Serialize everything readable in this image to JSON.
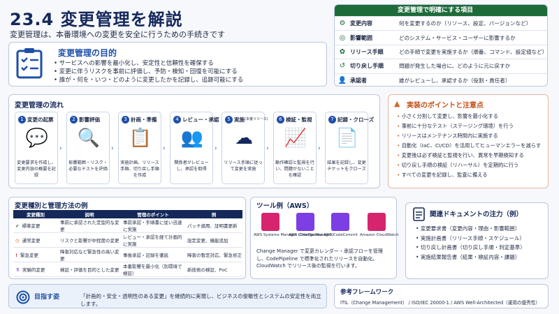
{
  "title": "23.4 変更管理を解説",
  "subtitle": "変更管理は、本番環境への変更を安全に行うための手続きです",
  "purpose": {
    "heading": "変更管理の目的",
    "items": [
      "サービスへの影響を最小化し、安定性と信頼性を確保する",
      "変更に伴うリスクを事前に評価し、予防・検知・回復を可能にする",
      "誰が・何を・いつ・どのように変更したかを記録し、追跡可能にする"
    ]
  },
  "clarify": {
    "heading": "変更管理で明確にする項目",
    "rows": [
      {
        "icon": "gear-icon",
        "key": "変更内容",
        "value": "何を変更するのか（リソース、設定、バージョンなど）"
      },
      {
        "icon": "impact-icon",
        "key": "影響範囲",
        "value": "どのシステム・サービス・ユーザーに影響するか"
      },
      {
        "icon": "release-icon",
        "key": "リリース手順",
        "value": "どの手順で変更を実施するか（順番、コマンド、設定値など）"
      },
      {
        "icon": "rollback-icon",
        "key": "切り戻し手順",
        "value": "問題が発生した場合に、どのように元に戻すか"
      },
      {
        "icon": "approver-icon",
        "key": "承認者",
        "value": "誰がレビューし、承認するか（役割・責任者）"
      }
    ]
  },
  "flow": {
    "heading": "変更管理の流れ",
    "steps": [
      {
        "num": "1",
        "name": "変更の起票",
        "desc": "変更要求を作成し、変更内容の概要を記録"
      },
      {
        "num": "2",
        "name": "影響評価",
        "desc": "影響範囲・リスク・必要なテストを評価"
      },
      {
        "num": "3",
        "name": "計画・準備",
        "desc": "実施計画、リリース手順、切り戻し手順を作成"
      },
      {
        "num": "4",
        "name": "レビュー・承認",
        "desc": "関係者がレビューし、承認を取得"
      },
      {
        "num": "5",
        "name": "実施",
        "sub": "(本番リリース)",
        "desc": "リリース手順に従って変更を実施"
      },
      {
        "num": "6",
        "name": "検証・監視",
        "desc": "動作確認と監視を行い、問題がないことを確認"
      },
      {
        "num": "7",
        "name": "記録・クローズ",
        "desc": "結果を記録し、変更チケットをクローズ"
      }
    ]
  },
  "points": {
    "heading": "実装のポイントと注意点",
    "items": [
      "小さく分割して変更し、影響を最小化する",
      "事前に十分なテスト（ステージング環境）を行う",
      "リリースはメンテナンス時間内に実施する",
      "自動化（IaC、CI/CD）を活用してヒューマンエラーを減らす",
      "変更後は必ず検証と監視を行い、異常を早期検知する",
      "切り戻し手順の検証（リハーサル）を定期的に行う",
      "すべての変更を記録し、監査に備える"
    ]
  },
  "types": {
    "heading": "変更種別と管理方法の例",
    "headers": [
      "変更種別",
      "説明",
      "管理のポイント",
      "例"
    ],
    "rows": [
      {
        "icon": "check-icon",
        "c": [
          "標準変更",
          "事前に承認された定型的な変更",
          "事前承認・手順書に従い迅速に実施",
          "パッチ適用、証明書更新"
        ]
      },
      {
        "icon": "clock-icon",
        "c": [
          "通常変更",
          "リスクと影響が中程度の変更",
          "レビュー・承認を経て計画的に実施",
          "設定変更、機能追加"
        ]
      },
      {
        "icon": "alert-icon",
        "c": [
          "緊急変更",
          "障害対応など緊急性の高い変更",
          "事後承認・記録を徹底",
          "障害の暫定対応、緊急修正"
        ]
      },
      {
        "icon": "flask-icon",
        "c": [
          "実験的変更",
          "検証・評価を目的とした変更",
          "本番影響を最小化（別環境で検証）",
          "新技術の検証、PoC"
        ]
      }
    ]
  },
  "tools": {
    "heading": "ツール例（AWS）",
    "badge": "AWS",
    "items": [
      "AWS Systems Manager (Change Manager)",
      "AWS CodePipeline",
      "AWS CodeCommit",
      "Amazon CloudWatch"
    ],
    "note": "Change Manager で変更カレンダー・承認フローを管理し、CodePipeline で標準化されたリリースを自動化。CloudWatch でリリース後の監視を行います。"
  },
  "docs": {
    "heading": "関連ドキュメントの注力（例）",
    "items": [
      "変更要求書（変更内容・理由・影響範囲）",
      "実施計画書（リリース手順・スケジュール）",
      "切り戻し計画書（切り戻し手順・判定基準）",
      "実施結果報告書（結果・検証内容・課題）"
    ]
  },
  "goal": {
    "label": "目指す姿",
    "text": "「計画的・安全・透明性のある変更」を継続的に実現し、ビジネスの俊敏性とシステムの安定性を両立します。"
  },
  "ref": {
    "label": "参考フレームワーク",
    "text": "ITIL（Change Management） / ISO/IEC 20000-1 / AWS Well-Architected（運用の優秀性）"
  },
  "colors": {
    "navy": "#14285a",
    "blue": "#1e4fa8",
    "green": "#1e6b3a",
    "orange": "#d9622b"
  }
}
